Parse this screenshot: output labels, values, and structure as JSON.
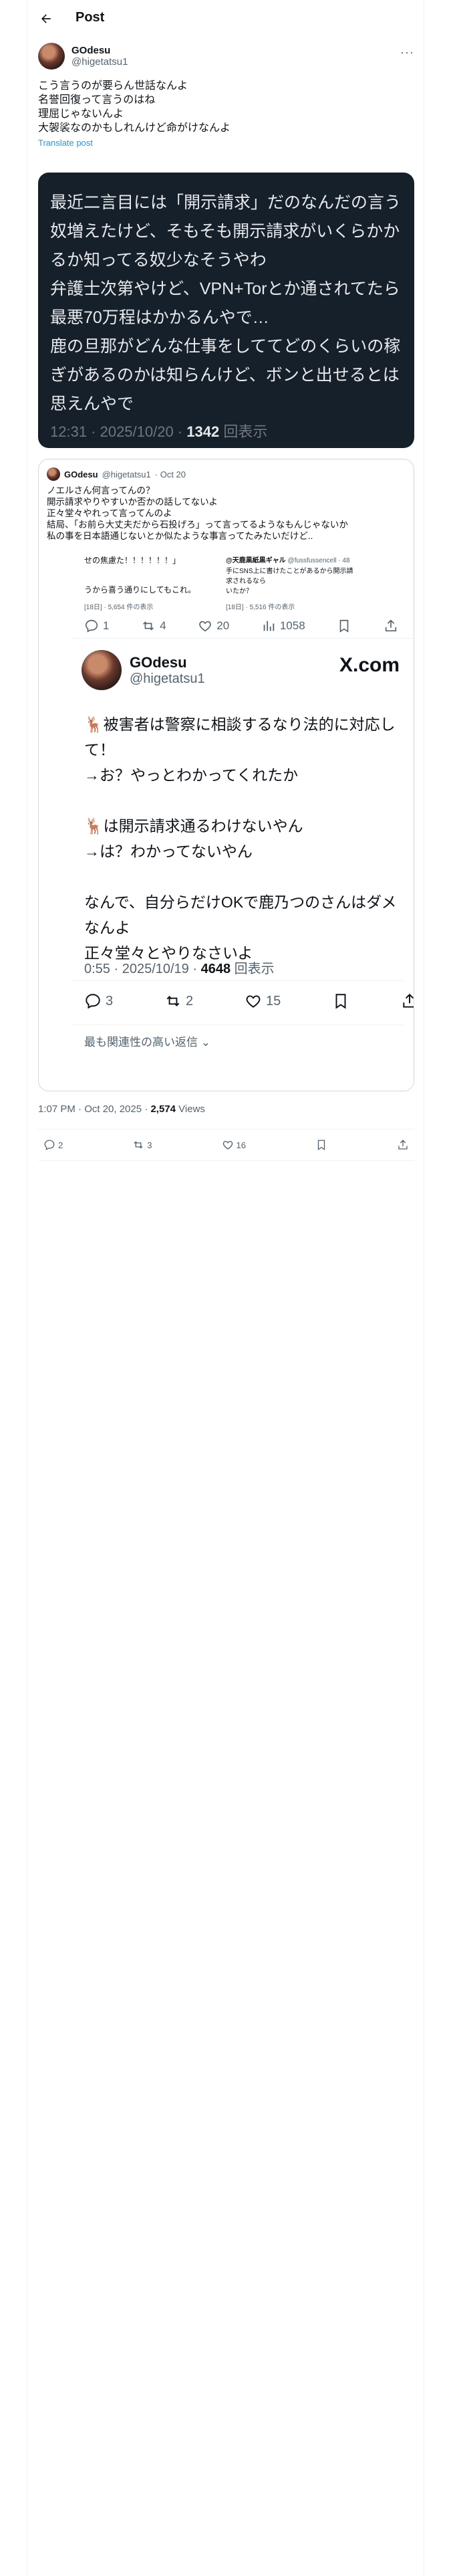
{
  "header": {
    "title": "Post",
    "back_label": "←"
  },
  "post": {
    "author_name": "GOdesu",
    "author_handle": "@higetatsu1",
    "more_label": "···",
    "text": "こう言うのが要らん世話なんよ\n名誉回復って言うのはね\n理屈じゃないんよ\n大袈裟なのかもしれんけど命がけなんよ",
    "translate": "Translate post",
    "timestamp": "1:07 PM · Oct 20, 2025",
    "views_count": "2,574",
    "views_label": "Views",
    "replies": "2",
    "reposts": "3",
    "likes": "16"
  },
  "dark_card": {
    "text": "最近二言目には「開示請求」だのなんだの言う奴増えたけど、そもそも開示請求がいくらかかるか知ってる奴少なそうやわ\n弁護士次第やけど、VPN+Torとか通されてたら最悪70万程はかかるんやで…\n鹿の旦那がどんな仕事をしててどのくらいの稼ぎがあるのかは知らんけど、ボンと出せるとは思えんやで",
    "meta_time": "12:31 · 2025/10/20 · ",
    "meta_count": "1342",
    "meta_suffix": " 回表示"
  },
  "quote": {
    "author_name": "GOdesu",
    "author_handle": "@higetatsu1",
    "date": "· Oct 20",
    "text": "ノエルさん何言ってんの？\n開示請求やりやすいか否かの話してないよ\n正々堂々やれって言ってんのよ\n結局、「お前ら大丈夫だから石投げろ」って言ってるようなもんじゃないか\n私の事を日本語通じないとか似たような事言ってたみたいだけど..",
    "inner_top": {
      "left_text": "せの焦慮た！！！！！！」",
      "left_text2": "うから喜う通りにしてもこれ。",
      "left_meta": "[18日] · 5,654 件の表示",
      "right_name": "@天鹿黒紙黒ギャル",
      "right_handle": "@fussfussencell · 48",
      "right_text": "手にSNS上に書けたことがあるから開示請求されるなら\nいたか？",
      "right_meta": "[18日] · 5,516 件の表示",
      "replies": "1",
      "reposts": "4",
      "likes": "20",
      "views": "1058"
    },
    "inner_card": {
      "name": "GOdesu",
      "handle": "@higetatsu1",
      "logo": "X.com",
      "text": "🦌被害者は警察に相談するなり法的に対応して！\n→お？やっとわかってくれたか\n\n🦌は開示請求通るわけないやん\n→は？わかってないやん\n\nなんで、自分らだけOKで鹿乃つのさんはダメなんよ\n正々堂々とやりなさいよ",
      "meta_time": "0:55 · 2025/10/19 · ",
      "meta_count": "4648",
      "meta_suffix": " 回表示",
      "replies": "3",
      "reposts": "2",
      "likes": "15",
      "relevant": "最も関連性の高い返信 ⌄"
    }
  }
}
